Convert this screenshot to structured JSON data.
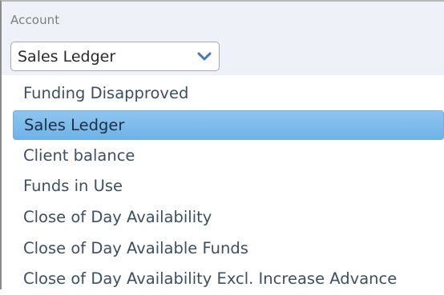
{
  "account_field": {
    "label": "Account",
    "selected_value": "Sales Ledger",
    "dropdown_icon": "chevron-down-icon",
    "options": [
      "Funding Disapproved",
      "Sales Ledger",
      "Client balance",
      "Funds in Use",
      "Close of Day Availability",
      "Close of Day Available Funds",
      "Close of Day Availability Excl. Increase Advance"
    ],
    "selected_index": 1
  },
  "colors": {
    "highlight": "#7ab9ea",
    "option_text": "#3d4f63",
    "label_text": "#7d7d7d",
    "chevron": "#4a78b5"
  }
}
